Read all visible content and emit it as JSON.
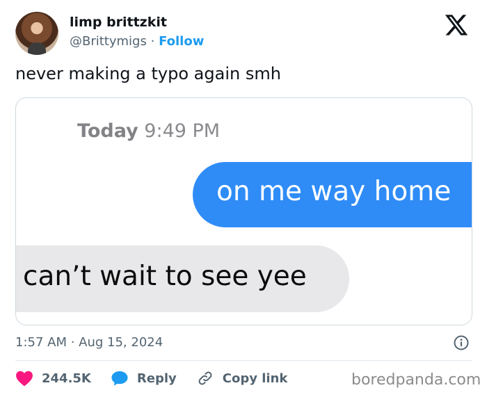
{
  "author": {
    "display_name": "limp brittzkit",
    "handle": "@Brittymigs",
    "separator": "·",
    "follow_label": "Follow"
  },
  "tweet": {
    "text": "never making a typo again smh",
    "timestamp": "1:57 AM · Aug 15, 2024"
  },
  "media": {
    "day": "Today",
    "time": "9:49 PM",
    "sent_message": "on me way home",
    "received_message": "can’t wait to see yee"
  },
  "actions": {
    "like_count": "244.5K",
    "reply_label": "Reply",
    "copy_link_label": "Copy link"
  },
  "watermark": "boredpanda.com",
  "icons": {
    "brand": "x-logo-icon",
    "like": "heart-icon",
    "reply": "speech-bubble-icon",
    "copy": "link-icon",
    "info": "info-icon"
  },
  "colors": {
    "link": "#1d9bf0",
    "heart": "#f91880",
    "reply_bubble": "#1d9bf0",
    "sent_bubble": "#2f8cf7",
    "received_bubble": "#e8e8ea",
    "muted_text": "#536471"
  }
}
